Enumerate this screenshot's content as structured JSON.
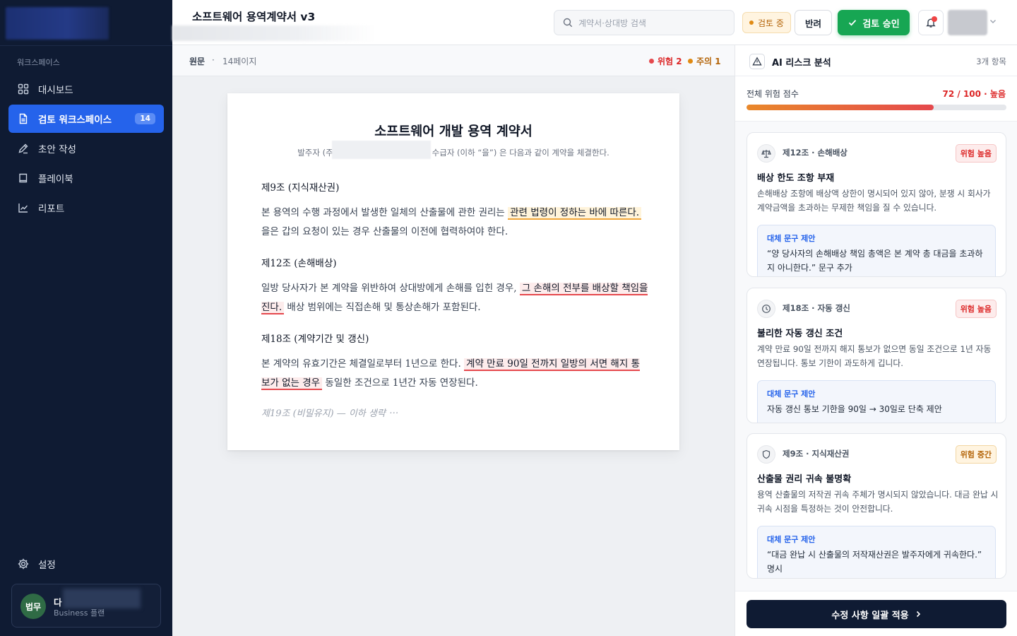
{
  "sidebar": {
    "workspace_heading": "워크스페이스",
    "items": [
      {
        "label": "대시보드",
        "icon": "grid-icon"
      },
      {
        "label": "검토 워크스페이스",
        "icon": "document-icon",
        "badge": "14",
        "active": true
      },
      {
        "label": "초안 작성",
        "icon": "pen-icon"
      },
      {
        "label": "플레이북",
        "icon": "book-icon"
      },
      {
        "label": "리포트",
        "icon": "chart-line-icon"
      }
    ],
    "settings_label": "설정",
    "user": {
      "avatar_text": "법무",
      "name": "다",
      "plan": "Business 플랜"
    }
  },
  "header": {
    "title": "소프트웨어 용역계약서 v3",
    "search_placeholder": "계약서·상대방 검색",
    "status": "검토 중",
    "reject_label": "반려",
    "approve_label": "검토 승인"
  },
  "document": {
    "toolbar": {
      "view_label": "원문",
      "separator": "·",
      "pages": "14페이지",
      "risk_label": "위험 2",
      "warn_label": "주의 1"
    },
    "title": "소프트웨어 개발 용역 계약서",
    "subtitle_left": "발주자 (주",
    "subtitle_right": "수급자 (이하 “을”) 은 다음과 같이 계약을 체결한다.",
    "clauses": [
      {
        "heading": "제9조 (지식재산권)",
        "before": "본 용역의 수행 과정에서 발생한 일체의 산출물에 관한 권리는 ",
        "highlight": "관련 법령이 정하는 바에 따른다.",
        "after": " 을은 갑의 요청이 있는 경우 산출물의 이전에 협력하여야 한다."
      },
      {
        "heading": "제12조 (손해배상)",
        "before": "일방 당사자가 본 계약을 위반하여 상대방에게 손해를 입힌 경우, ",
        "highlight": "그 손해의 전부를 배상할 책임을 진다.",
        "after": " 배상 범위에는 직접손해 및 통상손해가 포함된다."
      },
      {
        "heading": "제18조 (계약기간 및 갱신)",
        "before": "본 계약의 유효기간은 체결일로부터 1년으로 한다. ",
        "highlight": "계약 만료 90일 전까지 일방의 서면 해지 통보가 없는 경우",
        "after": " 동일한 조건으로 1년간 자동 연장된다."
      }
    ],
    "omitted": "제19조 (비밀유지) — 이하 생략 ⋯"
  },
  "panel": {
    "title": "AI 리스크 분석",
    "count": "3개 항목",
    "score_label": "전체 위험 점수",
    "score_text": "72 / 100 · 높음",
    "score_fraction": 0.72,
    "cards": [
      {
        "ref": "제12조 · 손해배상",
        "tag": "위험 높음",
        "level": "high",
        "icon": "scale-icon",
        "title": "배상 한도 조항 부재",
        "desc": "손해배상 조항에 배상액 상한이 명시되어 있지 않아, 분쟁 시 회사가 계약금액을 초과하는 무제한 책임을 질 수 있습니다.",
        "suggest_label": "대체 문구 제안",
        "suggest": "“양 당사자의 손해배상 책임 총액은 본 계약 총 대금을 초과하지 아니한다.” 문구 추가"
      },
      {
        "ref": "제18조 · 자동 갱신",
        "tag": "위험 높음",
        "level": "high",
        "icon": "clock-icon",
        "title": "불리한 자동 갱신 조건",
        "desc": "계약 만료 90일 전까지 해지 통보가 없으면 동일 조건으로 1년 자동 연장됩니다. 통보 기한이 과도하게 깁니다.",
        "suggest_label": "대체 문구 제안",
        "suggest": "자동 갱신 통보 기한을 90일 → 30일로 단축 제안"
      },
      {
        "ref": "제9조 · 지식재산권",
        "tag": "위험 중간",
        "level": "mid",
        "icon": "shield-icon",
        "title": "산출물 권리 귀속 불명확",
        "desc": "용역 산출물의 저작권 귀속 주체가 명시되지 않았습니다. 대금 완납 시 귀속 시점을 특정하는 것이 안전합니다.",
        "suggest_label": "대체 문구 제안",
        "suggest": "“대금 완납 시 산출물의 저작재산권은 발주자에게 귀속한다.” 명시"
      }
    ],
    "apply_label": "수정 사항 일괄 적용"
  },
  "colors": {
    "sidebar": "#0f1b33",
    "accent": "#2563eb",
    "approve": "#17a653",
    "danger": "#dc2626",
    "warning": "#e08a12"
  }
}
